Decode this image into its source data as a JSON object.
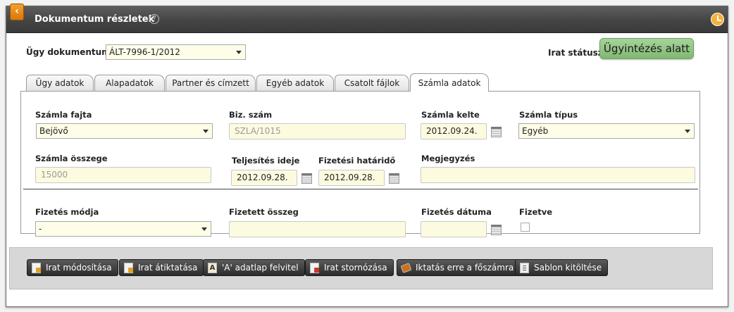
{
  "window": {
    "title": "Dokumentum részletek",
    "back_icon_glyph": "‹",
    "help_glyph": "?"
  },
  "header": {
    "case_docs_label": "Ügy dokumentumai:",
    "case_docs_value": "ÁLT-7996-1/2012",
    "status_label": "Irat státusza:",
    "status_value": "Ügyintézés alatt",
    "status_color": "#8cc27e"
  },
  "tabs": [
    {
      "label": "Ügy adatok",
      "active": false
    },
    {
      "label": "Alapadatok",
      "active": false
    },
    {
      "label": "Partner és címzett",
      "active": false
    },
    {
      "label": "Egyéb adatok",
      "active": false
    },
    {
      "label": "Csatolt fájlok",
      "active": false
    },
    {
      "label": "Számla adatok",
      "active": true
    }
  ],
  "form": {
    "invoice_kind": {
      "label": "Számla fajta",
      "value": "Bejövő"
    },
    "doc_number": {
      "label": "Biz. szám",
      "value": "SZLA/1015"
    },
    "invoice_date": {
      "label": "Számla kelte",
      "value": "2012.09.24."
    },
    "invoice_type": {
      "label": "Számla típus",
      "value": "Egyéb"
    },
    "invoice_amount": {
      "label": "Számla összege",
      "value": "15000"
    },
    "completion_date": {
      "label": "Teljesítés ideje",
      "value": "2012.09.28."
    },
    "payment_deadline": {
      "label": "Fizetési határidő",
      "value": "2012.09.28."
    },
    "remark": {
      "label": "Megjegyzés",
      "value": ""
    },
    "payment_method": {
      "label": "Fizetés módja",
      "value": "-"
    },
    "paid_amount": {
      "label": "Fizetett összeg",
      "value": ""
    },
    "payment_date": {
      "label": "Fizetés dátuma",
      "value": ""
    },
    "paid": {
      "label": "Fizetve",
      "checked": false
    }
  },
  "actions": [
    {
      "label": "Irat módosítása",
      "icon": "edit-document-icon"
    },
    {
      "label": "Irat átiktatása",
      "icon": "transfer-document-icon"
    },
    {
      "label": "'A' adatlap felvitel",
      "icon": "letter-a-icon"
    },
    {
      "label": "Irat stornózása",
      "icon": "cancel-document-icon"
    },
    {
      "label": "Iktatás erre a főszámra",
      "icon": "ledger-icon"
    },
    {
      "label": "Sablon kitöltése",
      "icon": "clipboard-icon"
    }
  ]
}
